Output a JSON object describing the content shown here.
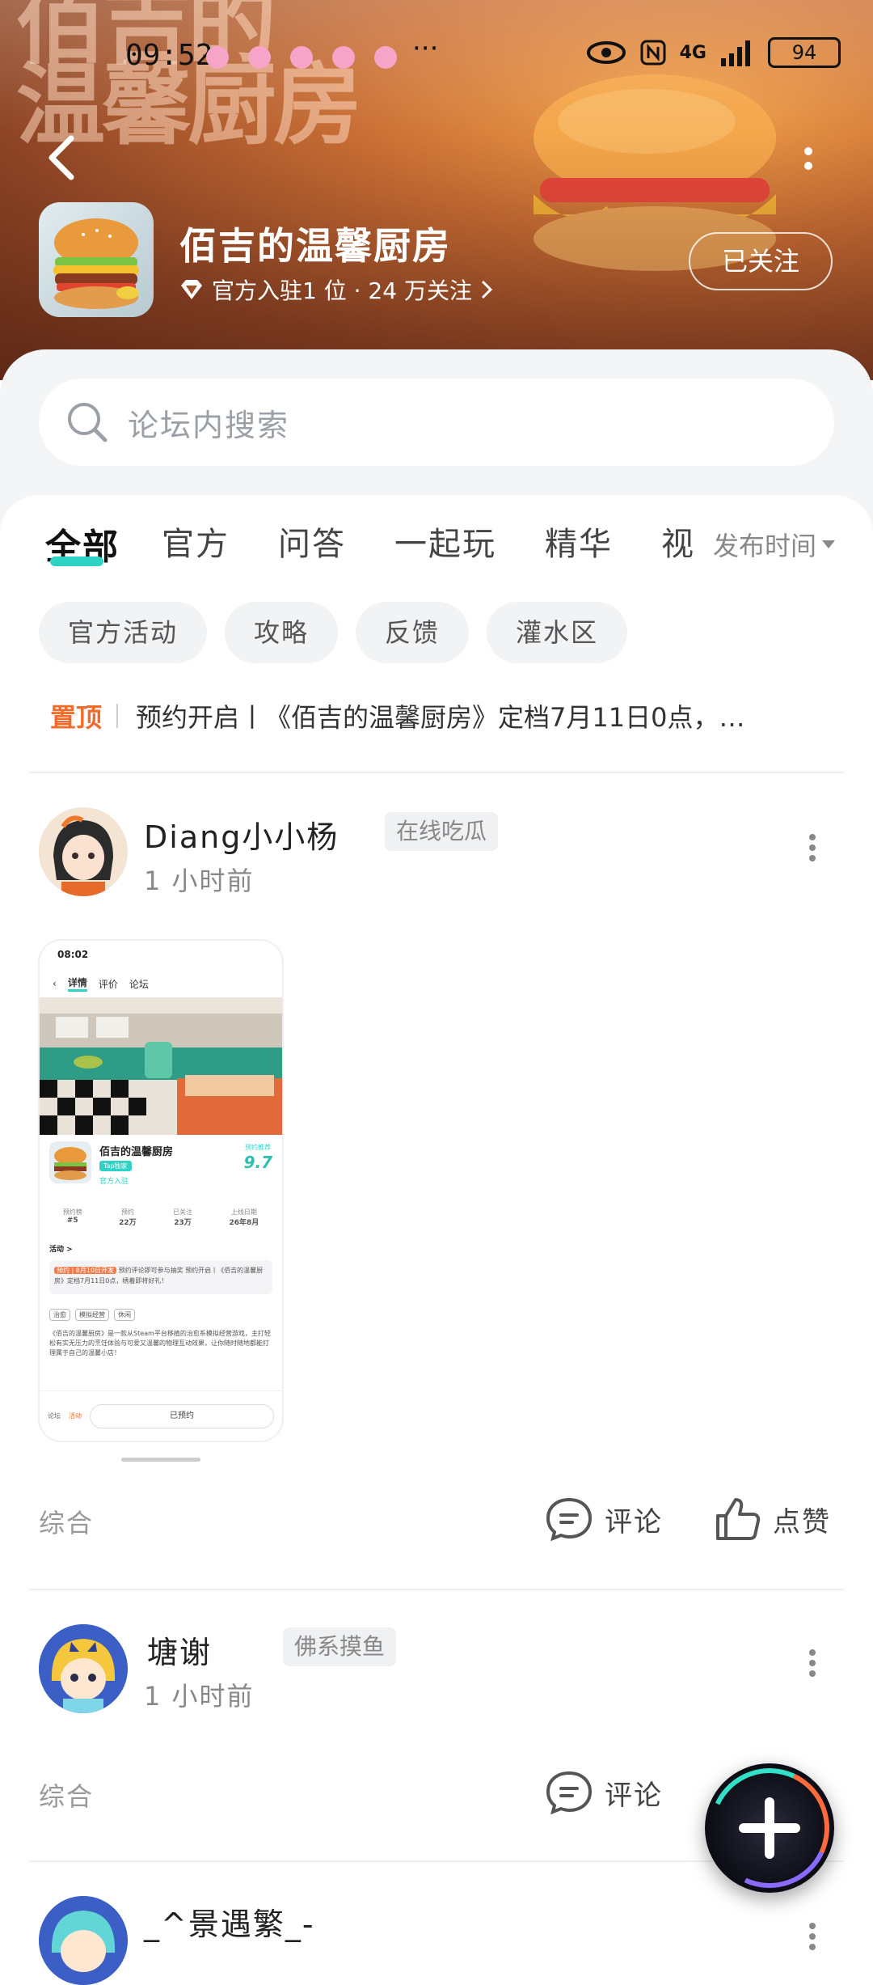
{
  "statusbar": {
    "time": "09:52",
    "network": "4G",
    "battery": "94"
  },
  "header": {
    "title": "佰吉的温馨厨房",
    "subtitle": "官方入驻1 位 · 24 万关注",
    "follow_label": "已关注",
    "bg_title": "佰吉的\n温馨厨房"
  },
  "search": {
    "placeholder": "论坛内搜索"
  },
  "tabs": [
    {
      "label": "全部",
      "active": true
    },
    {
      "label": "官方"
    },
    {
      "label": "问答"
    },
    {
      "label": "一起玩"
    },
    {
      "label": "精华"
    },
    {
      "label": "视"
    }
  ],
  "sort": {
    "label": "发布时间"
  },
  "chips": [
    "官方活动",
    "攻略",
    "反馈",
    "灌水区"
  ],
  "pinned": {
    "tag": "置顶",
    "text": "预约开启丨《佰吉的温馨厨房》定档7月11日0点，…"
  },
  "posts": [
    {
      "username": "Diang小小杨",
      "badge": "在线吃瓜",
      "time": "1 小时前",
      "type": "综合",
      "comment_label": "评论",
      "like_label": "点赞",
      "thumb": {
        "time": "08:02",
        "nav": [
          "详情",
          "评价",
          "论坛"
        ],
        "game_name": "佰吉的温馨厨房",
        "tag": "Tap独家",
        "official": "官方入驻",
        "score_label": "预约推荐",
        "score": "9.7",
        "stats": [
          {
            "value": "#5",
            "label": "预约榜"
          },
          {
            "value": "22万",
            "label": "预约"
          },
          {
            "value": "23万",
            "label": "已关注"
          },
          {
            "value": "26年8月",
            "label": "上线日期"
          }
        ],
        "activity_title": "活动 >",
        "activity_tag": "预约 | 8月10日开发",
        "activity_text": "预约评论即可参与抽奖 预约开启丨《佰吉的温馨厨房》定档7月11日0点，绣着即将好礼！",
        "tags": [
          "治愈",
          "模拟经营",
          "休闲"
        ],
        "desc": "《佰吉的温馨厨房》是一款从Steam平台移植的治愈系模拟经营游戏，主打轻松有实无压力的烹饪体验与可爱又温馨的物理互动效果，让你随时随地都能打理属于自己的温馨小店！",
        "bottom_left": "论坛",
        "bottom_mid": "活动",
        "reserved": "已预约"
      }
    },
    {
      "username": "塘谢",
      "badge": "佛系摸鱼",
      "time": "1 小时前",
      "type": "综合",
      "comment_label": "评论"
    },
    {
      "username": "_^景遇繁_-"
    }
  ],
  "colors": {
    "accent": "#2fd3c6",
    "pinned": "#f06b2c"
  }
}
